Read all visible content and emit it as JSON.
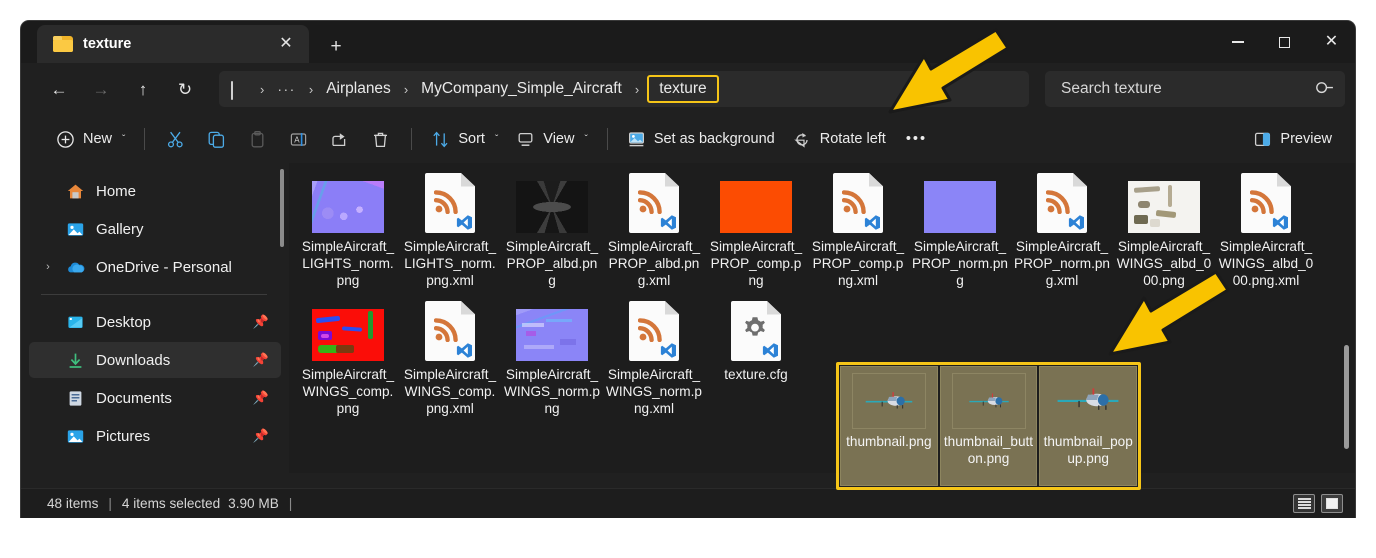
{
  "window": {
    "tab_title": "texture",
    "tab_close_label": "✕",
    "new_tab_label": "+",
    "minimize_label": "",
    "maximize_label": "",
    "close_label": "✕"
  },
  "nav": {
    "back": "←",
    "forward": "→",
    "up": "↑",
    "refresh": "↻"
  },
  "breadcrumb": {
    "ellipsis": "···",
    "separator": "›",
    "items": [
      {
        "label": "Airplanes",
        "current": false
      },
      {
        "label": "MyCompany_Simple_Aircraft",
        "current": false
      },
      {
        "label": "texture",
        "current": true
      }
    ]
  },
  "search": {
    "placeholder": "Search texture",
    "value": ""
  },
  "toolbar": {
    "new_label": "New",
    "cut_label": "Cut",
    "copy_label": "Copy",
    "paste_label": "Paste",
    "rename_label": "Rename",
    "share_label": "Share",
    "delete_label": "Delete",
    "sort_label": "Sort",
    "view_label": "View",
    "set_as_background_label": "Set as background",
    "rotate_left_label": "Rotate left",
    "more_label": "•••",
    "preview_label": "Preview",
    "chevron": "ˇ"
  },
  "sidebar": {
    "items": [
      {
        "label": "Home",
        "icon": "home-icon",
        "pinned": false,
        "expandable": false,
        "selected": false
      },
      {
        "label": "Gallery",
        "icon": "gallery-icon",
        "pinned": false,
        "expandable": false,
        "selected": false
      },
      {
        "label": "OneDrive - Personal",
        "icon": "onedrive-icon",
        "pinned": false,
        "expandable": true,
        "selected": false
      },
      {
        "label": "Desktop",
        "icon": "desktop-icon",
        "pinned": true,
        "expandable": false,
        "selected": false
      },
      {
        "label": "Downloads",
        "icon": "downloads-icon",
        "pinned": true,
        "expandable": false,
        "selected": true
      },
      {
        "label": "Documents",
        "icon": "documents-icon",
        "pinned": true,
        "expandable": false,
        "selected": false
      },
      {
        "label": "Pictures",
        "icon": "pictures-icon",
        "pinned": true,
        "expandable": false,
        "selected": false
      }
    ]
  },
  "files": {
    "row1": [
      {
        "name": "SimpleAircraft_LIGHTS_norm.png",
        "kind": "image-norm-lights"
      },
      {
        "name": "SimpleAircraft_LIGHTS_norm.png.xml",
        "kind": "xml"
      },
      {
        "name": "SimpleAircraft_PROP_albd.png",
        "kind": "image-prop-albd"
      },
      {
        "name": "SimpleAircraft_PROP_albd.png.xml",
        "kind": "xml"
      },
      {
        "name": "SimpleAircraft_PROP_comp.png",
        "kind": "image-prop-comp"
      },
      {
        "name": "SimpleAircraft_PROP_comp.png.xml",
        "kind": "xml"
      },
      {
        "name": "SimpleAircraft_PROP_norm.png",
        "kind": "image-prop-norm"
      },
      {
        "name": "SimpleAircraft_PROP_norm.png.xml",
        "kind": "xml"
      },
      {
        "name": "SimpleAircraft_WINGS_albd_000.png",
        "kind": "image-wing-albd"
      },
      {
        "name": "SimpleAircraft_WINGS_albd_000.png.xml",
        "kind": "xml"
      }
    ],
    "row2": [
      {
        "name": "SimpleAircraft_WINGS_comp.png",
        "kind": "image-wing-comp"
      },
      {
        "name": "SimpleAircraft_WINGS_comp.png.xml",
        "kind": "xml"
      },
      {
        "name": "SimpleAircraft_WINGS_norm.png",
        "kind": "image-wing-norm"
      },
      {
        "name": "SimpleAircraft_WINGS_norm.png.xml",
        "kind": "xml"
      },
      {
        "name": "texture.cfg",
        "kind": "cfg"
      }
    ],
    "selected": [
      {
        "name": "thumbnail.png",
        "kind": "image-plane",
        "plane_scale": 0.72
      },
      {
        "name": "thumbnail_button.png",
        "kind": "image-plane",
        "plane_scale": 0.58
      },
      {
        "name": "thumbnail_popup.png",
        "kind": "image-plane",
        "plane_scale": 0.95
      }
    ]
  },
  "status": {
    "item_count": "48 items",
    "separator": "|",
    "selection": "4 items selected",
    "size": "3.90 MB",
    "trailing_separator": "|",
    "details_view_label": "Details view",
    "large_icons_view_label": "Large icons view"
  },
  "annotations": {
    "arrow_color": "#f9c300",
    "highlight_color": "#f5c518",
    "arrow1_target": "texture breadcrumb",
    "arrow2_target": "selected thumbnail files"
  }
}
